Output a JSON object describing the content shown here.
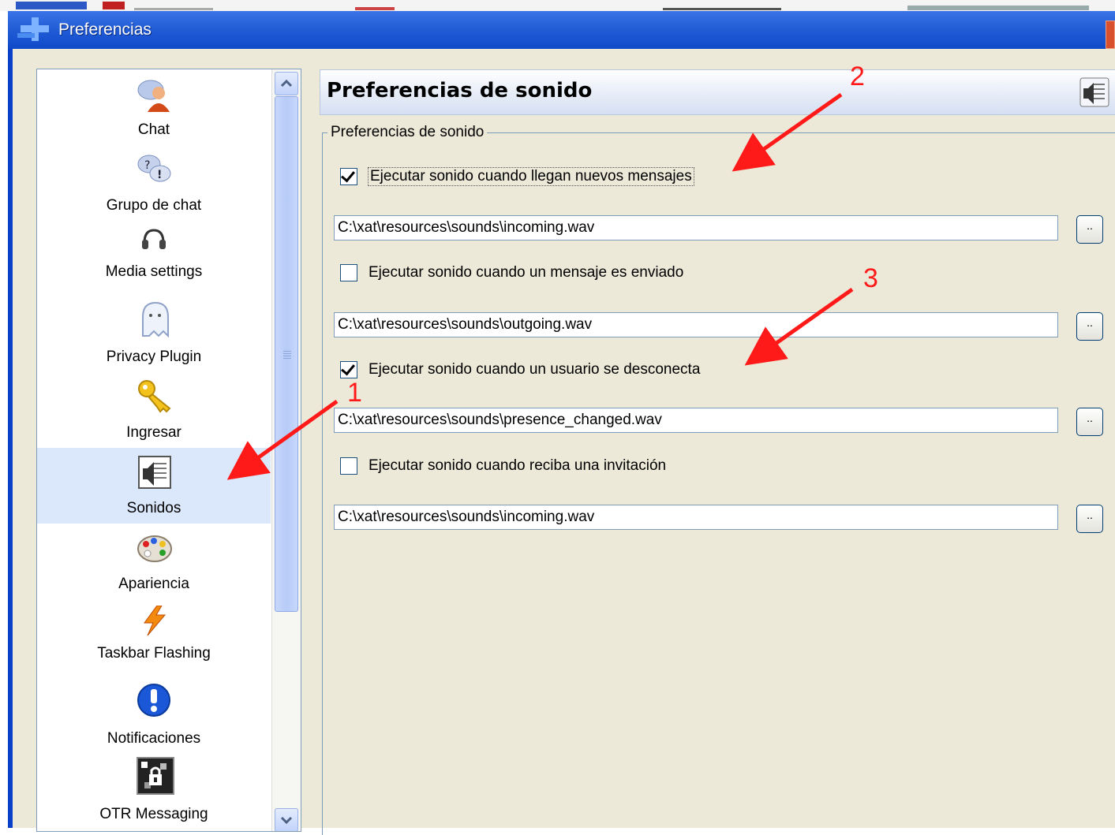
{
  "window": {
    "title": "Preferencias"
  },
  "nav": {
    "items": [
      {
        "label": "Chat",
        "icon": "user-chat-icon"
      },
      {
        "label": "Grupo de chat",
        "icon": "group-chat-icon"
      },
      {
        "label": "Media settings",
        "icon": "headset-icon"
      },
      {
        "label": "Privacy Plugin",
        "icon": "ghost-icon"
      },
      {
        "label": "Ingresar",
        "icon": "key-icon"
      },
      {
        "label": "Sonidos",
        "icon": "speaker-doc-icon",
        "selected": true
      },
      {
        "label": "Apariencia",
        "icon": "palette-icon"
      },
      {
        "label": "Taskbar Flashing",
        "icon": "lightning-icon"
      },
      {
        "label": "Notificaciones",
        "icon": "alert-icon"
      },
      {
        "label": "OTR Messaging",
        "icon": "lock-icon"
      }
    ]
  },
  "panel": {
    "header_title": "Preferencias de sonido",
    "group_legend": "Preferencias de sonido",
    "settings": [
      {
        "label": "Ejecutar sonido cuando llegan nuevos mensajes",
        "checked": true,
        "path": "C:\\xat\\resources\\sounds\\incoming.wav"
      },
      {
        "label": "Ejecutar sonido cuando un mensaje es enviado",
        "checked": false,
        "path": "C:\\xat\\resources\\sounds\\outgoing.wav"
      },
      {
        "label": "Ejecutar sonido cuando un usuario se desconecta",
        "checked": true,
        "path": "C:\\xat\\resources\\sounds\\presence_changed.wav"
      },
      {
        "label": "Ejecutar sonido cuando reciba una invitación",
        "checked": false,
        "path": "C:\\xat\\resources\\sounds\\incoming.wav"
      }
    ],
    "browse_label": ".."
  },
  "annotations": {
    "one": "1",
    "two": "2",
    "three": "3",
    "arrow_color": "#ff1a1a"
  }
}
